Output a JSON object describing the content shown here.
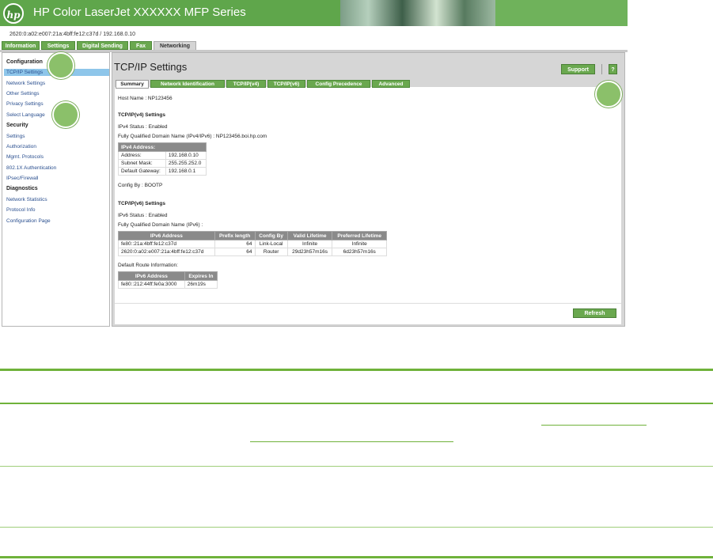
{
  "banner": {
    "logo_text": "hp",
    "product_name": "HP Color LaserJet XXXXXX MFP Series"
  },
  "ip_address_line": "2620:0:a02:e007:21a:4bff:fe12:c37d / 192.168.0.10",
  "top_tabs": [
    {
      "label": "Information",
      "active": false
    },
    {
      "label": "Settings",
      "active": false
    },
    {
      "label": "Digital Sending",
      "active": false
    },
    {
      "label": "Fax",
      "active": false
    },
    {
      "label": "Networking",
      "active": true
    }
  ],
  "sidebar": {
    "sections": [
      {
        "heading": "Configuration",
        "items": [
          "TCP/IP Settings",
          "Network Settings",
          "Other Settings",
          "Privacy Settings",
          "Select Language"
        ]
      },
      {
        "heading": "Security",
        "items": [
          "Settings",
          "Authorization",
          "Mgmt. Protocols",
          "802.1X Authentication",
          "IPsec/Firewall"
        ]
      },
      {
        "heading": "Diagnostics",
        "items": [
          "Network Statistics",
          "Protocol Info",
          "Configuration Page"
        ]
      }
    ],
    "selected": "TCP/IP Settings"
  },
  "main": {
    "title": "TCP/IP Settings",
    "support_label": "Support",
    "help_label": "?",
    "subtabs": [
      "Summary",
      "Network Identification",
      "TCP/IP(v4)",
      "TCP/IP(v6)",
      "Config Precedence",
      "Advanced"
    ],
    "active_subtab": "Summary",
    "host_name": "Host Name : NP123456",
    "ipv4": {
      "heading": "TCP/IP(v4) Settings",
      "status": "IPv4 Status : Enabled",
      "fqdn": "Fully Qualified Domain Name (IPv4/IPv6) : NP123456.boi.hp.com",
      "table_header": "IPv4 Address:",
      "rows": [
        {
          "label": "Address:",
          "value": "192.168.0.10"
        },
        {
          "label": "Subnet Mask:",
          "value": "255.255.252.0"
        },
        {
          "label": "Default Gateway:",
          "value": "192.168.0.1"
        }
      ],
      "config_by": "Config By : BOOTP"
    },
    "ipv6": {
      "heading": "TCP/IP(v6) Settings",
      "status": "IPv6 Status : Enabled",
      "fqdn": "Fully Qualified Domain Name (IPv6) :",
      "columns": [
        "IPv6 Address",
        "Prefix length",
        "Config By",
        "Valid Lifetime",
        "Preferred Lifetime"
      ],
      "rows": [
        [
          "fe80::21a:4bff:fe12:c37d",
          "64",
          "Link-Local",
          "Infinite",
          "Infinite"
        ],
        [
          "2620:0:a02:e007:21a:4bff:fe12:c37d",
          "64",
          "Router",
          "29d23h57m16s",
          "6d23h57m16s"
        ]
      ],
      "default_route_label": "Default Route Information:",
      "route_columns": [
        "IPv6 Address",
        "Expires In"
      ],
      "route_rows": [
        [
          "fe80::212:44ff:fe0a:3000",
          "26m19s"
        ]
      ]
    },
    "refresh_label": "Refresh"
  },
  "colors": {
    "hp_green": "#6aa84f",
    "banner_green": "#5fa64b",
    "callout_green": "#8bc06a",
    "link_blue": "#2a4f8f"
  }
}
